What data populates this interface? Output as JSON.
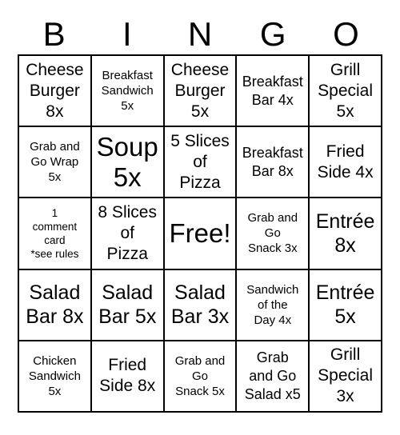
{
  "header": {
    "letters": [
      "B",
      "I",
      "N",
      "G",
      "O"
    ]
  },
  "grid": {
    "rows": 5,
    "columns": 5,
    "border_color": "#000000",
    "background_color": "#ffffff",
    "text_color": "#000000",
    "cells": [
      {
        "text": "Cheese\nBurger\n8x",
        "size": "fs-l"
      },
      {
        "text": "Breakfast\nSandwich\n5x",
        "size": "fs-s"
      },
      {
        "text": "Cheese\nBurger\n5x",
        "size": "fs-l"
      },
      {
        "text": "Breakfast\nBar 4x",
        "size": "fs-m"
      },
      {
        "text": "Grill\nSpecial\n5x",
        "size": "fs-l"
      },
      {
        "text": "Grab and\nGo Wrap\n5x",
        "size": "fs-s"
      },
      {
        "text": "Soup\n5x",
        "size": "fs-xxl"
      },
      {
        "text": "5 Slices\nof\nPizza",
        "size": "fs-l"
      },
      {
        "text": "Breakfast\nBar 8x",
        "size": "fs-m"
      },
      {
        "text": "Fried\nSide 4x",
        "size": "fs-l"
      },
      {
        "text": "1\ncomment\ncard\n*see rules",
        "size": "fs-xs"
      },
      {
        "text": "8 Slices\nof\nPizza",
        "size": "fs-l"
      },
      {
        "text": "Free!",
        "size": "fs-xxl"
      },
      {
        "text": "Grab and\nGo\nSnack 3x",
        "size": "fs-s"
      },
      {
        "text": "Entrée\n8x",
        "size": "fs-xl"
      },
      {
        "text": "Salad\nBar 8x",
        "size": "fs-xl"
      },
      {
        "text": "Salad\nBar 5x",
        "size": "fs-xl"
      },
      {
        "text": "Salad\nBar 3x",
        "size": "fs-xl"
      },
      {
        "text": "Sandwich\nof the\nDay 4x",
        "size": "fs-s"
      },
      {
        "text": "Entrée\n5x",
        "size": "fs-xl"
      },
      {
        "text": "Chicken\nSandwich\n5x",
        "size": "fs-s"
      },
      {
        "text": "Fried\nSide 8x",
        "size": "fs-l"
      },
      {
        "text": "Grab and\nGo\nSnack 5x",
        "size": "fs-s"
      },
      {
        "text": "Grab\nand Go\nSalad x5",
        "size": "fs-m"
      },
      {
        "text": "Grill\nSpecial\n3x",
        "size": "fs-l"
      }
    ]
  }
}
